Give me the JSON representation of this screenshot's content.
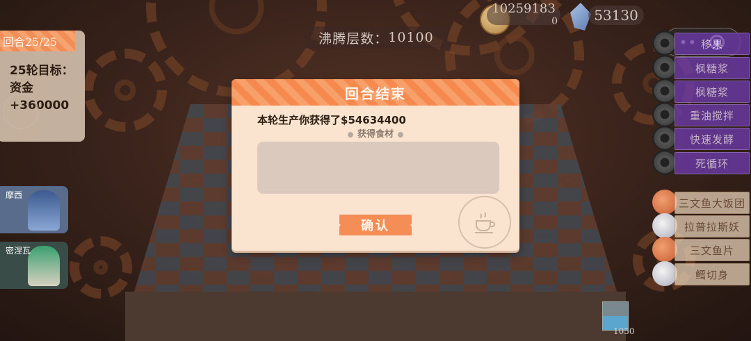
{
  "hud": {
    "boil_label": "沸腾层数：",
    "boil_value": "10100",
    "gold_top": "10259183",
    "gold_bottom": "0",
    "crystal_count": "53130"
  },
  "round": {
    "tag": "回合25/25",
    "goal_line1": "25轮目标：",
    "goal_line2": "资金+360000"
  },
  "characters": [
    {
      "name": "摩西"
    },
    {
      "name": "密涅瓦"
    }
  ],
  "right_panel": {
    "items": [
      {
        "label": "移果",
        "style": "purple",
        "icon": "gear-icon"
      },
      {
        "label": "枫糖浆",
        "style": "purple",
        "icon": "gear-icon"
      },
      {
        "label": "枫糖浆",
        "style": "purple",
        "icon": "gear-icon"
      },
      {
        "label": "重油搅拌",
        "style": "purple",
        "icon": "gear-icon"
      },
      {
        "label": "快速发酵",
        "style": "purple",
        "icon": "gear-icon"
      },
      {
        "label": "死循环",
        "style": "purple",
        "icon": "gear-icon"
      },
      {
        "label": "三文鱼大饭团",
        "style": "beige",
        "icon": "food-icon"
      },
      {
        "label": "拉普拉斯妖",
        "style": "beige",
        "icon": "white-food-icon"
      },
      {
        "label": "三文鱼片",
        "style": "beige",
        "icon": "food-icon"
      },
      {
        "label": "鳕切身",
        "style": "beige",
        "icon": "white-food-icon"
      }
    ],
    "menu_dots": "•••",
    "cup_value": "1050"
  },
  "modal": {
    "title": "回合结束",
    "earn_text": "本轮生产你获得了$54634400",
    "sub_heading": "获得食材",
    "confirm_label": "确认"
  }
}
